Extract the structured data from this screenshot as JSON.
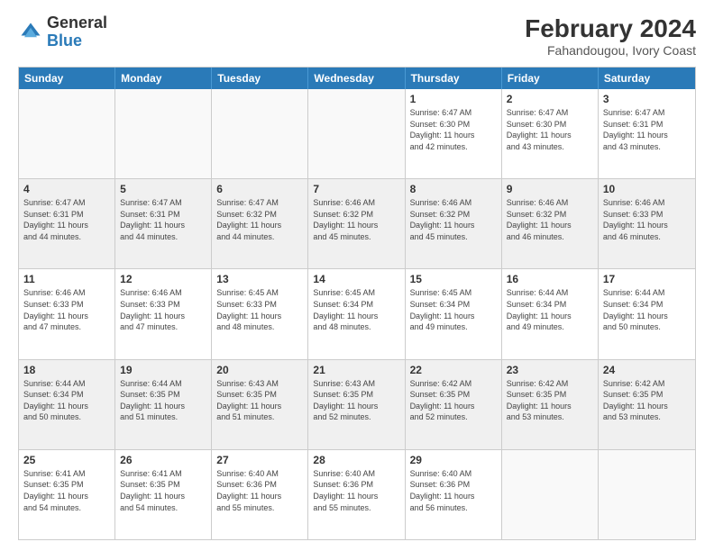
{
  "logo": {
    "general": "General",
    "blue": "Blue"
  },
  "title": "February 2024",
  "subtitle": "Fahandougou, Ivory Coast",
  "header_days": [
    "Sunday",
    "Monday",
    "Tuesday",
    "Wednesday",
    "Thursday",
    "Friday",
    "Saturday"
  ],
  "rows": [
    [
      {
        "day": "",
        "info": "",
        "empty": true
      },
      {
        "day": "",
        "info": "",
        "empty": true
      },
      {
        "day": "",
        "info": "",
        "empty": true
      },
      {
        "day": "",
        "info": "",
        "empty": true
      },
      {
        "day": "1",
        "info": "Sunrise: 6:47 AM\nSunset: 6:30 PM\nDaylight: 11 hours\nand 42 minutes."
      },
      {
        "day": "2",
        "info": "Sunrise: 6:47 AM\nSunset: 6:30 PM\nDaylight: 11 hours\nand 43 minutes."
      },
      {
        "day": "3",
        "info": "Sunrise: 6:47 AM\nSunset: 6:31 PM\nDaylight: 11 hours\nand 43 minutes."
      }
    ],
    [
      {
        "day": "4",
        "info": "Sunrise: 6:47 AM\nSunset: 6:31 PM\nDaylight: 11 hours\nand 44 minutes.",
        "shaded": true
      },
      {
        "day": "5",
        "info": "Sunrise: 6:47 AM\nSunset: 6:31 PM\nDaylight: 11 hours\nand 44 minutes.",
        "shaded": true
      },
      {
        "day": "6",
        "info": "Sunrise: 6:47 AM\nSunset: 6:32 PM\nDaylight: 11 hours\nand 44 minutes.",
        "shaded": true
      },
      {
        "day": "7",
        "info": "Sunrise: 6:46 AM\nSunset: 6:32 PM\nDaylight: 11 hours\nand 45 minutes.",
        "shaded": true
      },
      {
        "day": "8",
        "info": "Sunrise: 6:46 AM\nSunset: 6:32 PM\nDaylight: 11 hours\nand 45 minutes.",
        "shaded": true
      },
      {
        "day": "9",
        "info": "Sunrise: 6:46 AM\nSunset: 6:32 PM\nDaylight: 11 hours\nand 46 minutes.",
        "shaded": true
      },
      {
        "day": "10",
        "info": "Sunrise: 6:46 AM\nSunset: 6:33 PM\nDaylight: 11 hours\nand 46 minutes.",
        "shaded": true
      }
    ],
    [
      {
        "day": "11",
        "info": "Sunrise: 6:46 AM\nSunset: 6:33 PM\nDaylight: 11 hours\nand 47 minutes."
      },
      {
        "day": "12",
        "info": "Sunrise: 6:46 AM\nSunset: 6:33 PM\nDaylight: 11 hours\nand 47 minutes."
      },
      {
        "day": "13",
        "info": "Sunrise: 6:45 AM\nSunset: 6:33 PM\nDaylight: 11 hours\nand 48 minutes."
      },
      {
        "day": "14",
        "info": "Sunrise: 6:45 AM\nSunset: 6:34 PM\nDaylight: 11 hours\nand 48 minutes."
      },
      {
        "day": "15",
        "info": "Sunrise: 6:45 AM\nSunset: 6:34 PM\nDaylight: 11 hours\nand 49 minutes."
      },
      {
        "day": "16",
        "info": "Sunrise: 6:44 AM\nSunset: 6:34 PM\nDaylight: 11 hours\nand 49 minutes."
      },
      {
        "day": "17",
        "info": "Sunrise: 6:44 AM\nSunset: 6:34 PM\nDaylight: 11 hours\nand 50 minutes."
      }
    ],
    [
      {
        "day": "18",
        "info": "Sunrise: 6:44 AM\nSunset: 6:34 PM\nDaylight: 11 hours\nand 50 minutes.",
        "shaded": true
      },
      {
        "day": "19",
        "info": "Sunrise: 6:44 AM\nSunset: 6:35 PM\nDaylight: 11 hours\nand 51 minutes.",
        "shaded": true
      },
      {
        "day": "20",
        "info": "Sunrise: 6:43 AM\nSunset: 6:35 PM\nDaylight: 11 hours\nand 51 minutes.",
        "shaded": true
      },
      {
        "day": "21",
        "info": "Sunrise: 6:43 AM\nSunset: 6:35 PM\nDaylight: 11 hours\nand 52 minutes.",
        "shaded": true
      },
      {
        "day": "22",
        "info": "Sunrise: 6:42 AM\nSunset: 6:35 PM\nDaylight: 11 hours\nand 52 minutes.",
        "shaded": true
      },
      {
        "day": "23",
        "info": "Sunrise: 6:42 AM\nSunset: 6:35 PM\nDaylight: 11 hours\nand 53 minutes.",
        "shaded": true
      },
      {
        "day": "24",
        "info": "Sunrise: 6:42 AM\nSunset: 6:35 PM\nDaylight: 11 hours\nand 53 minutes.",
        "shaded": true
      }
    ],
    [
      {
        "day": "25",
        "info": "Sunrise: 6:41 AM\nSunset: 6:35 PM\nDaylight: 11 hours\nand 54 minutes."
      },
      {
        "day": "26",
        "info": "Sunrise: 6:41 AM\nSunset: 6:35 PM\nDaylight: 11 hours\nand 54 minutes."
      },
      {
        "day": "27",
        "info": "Sunrise: 6:40 AM\nSunset: 6:36 PM\nDaylight: 11 hours\nand 55 minutes."
      },
      {
        "day": "28",
        "info": "Sunrise: 6:40 AM\nSunset: 6:36 PM\nDaylight: 11 hours\nand 55 minutes."
      },
      {
        "day": "29",
        "info": "Sunrise: 6:40 AM\nSunset: 6:36 PM\nDaylight: 11 hours\nand 56 minutes."
      },
      {
        "day": "",
        "info": "",
        "empty": true
      },
      {
        "day": "",
        "info": "",
        "empty": true
      }
    ]
  ]
}
